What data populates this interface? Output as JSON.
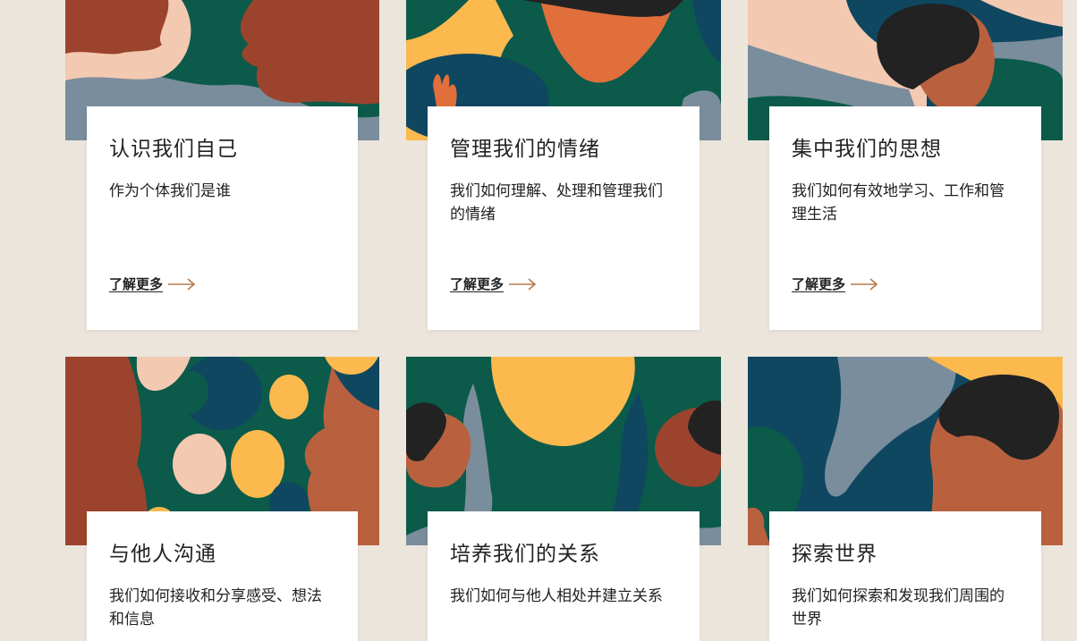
{
  "cards": [
    {
      "title": "认识我们自己",
      "desc": "作为个体我们是谁",
      "more": "了解更多"
    },
    {
      "title": "管理我们的情绪",
      "desc": "我们如何理解、处理和管理我们的情绪",
      "more": "了解更多"
    },
    {
      "title": "集中我们的思想",
      "desc": "我们如何有效地学习、工作和管理生活",
      "more": "了解更多"
    },
    {
      "title": "与他人沟通",
      "desc": "我们如何接收和分享感受、想法和信息"
    },
    {
      "title": "培养我们的关系",
      "desc": "我们如何与他人相处并建立关系"
    },
    {
      "title": "探索世界",
      "desc": "我们如何探索和发现我们周围的世界"
    }
  ],
  "colors": {
    "background": "#ece5dc",
    "green": "#0c5a4a",
    "navy": "#0f4760",
    "rust": "#9c432d",
    "orange": "#b9613f",
    "yellow": "#fbb94e",
    "peach": "#f3c9b1",
    "slate": "#7a8d9c",
    "black": "#222222",
    "arrow": "#b87a4a"
  },
  "icons": {
    "more_arrow": "arrow-right-icon"
  }
}
